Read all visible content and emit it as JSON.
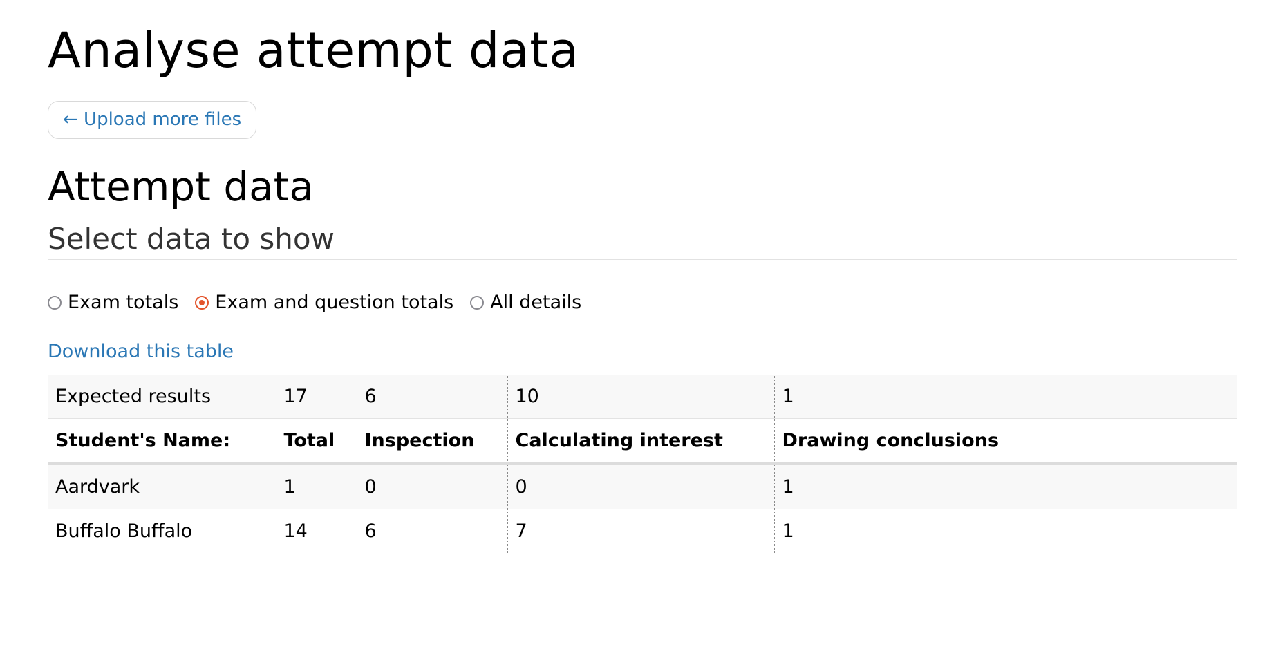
{
  "page": {
    "title": "Analyse attempt data",
    "upload_button": "← Upload more files",
    "section_title": "Attempt data",
    "subsection_title": "Select data to show"
  },
  "data_options": [
    {
      "label": "Exam totals",
      "selected": false
    },
    {
      "label": "Exam and question totals",
      "selected": true
    },
    {
      "label": "All details",
      "selected": false
    }
  ],
  "download_link": "Download this table",
  "table": {
    "expected": {
      "label": "Expected results",
      "values": [
        "17",
        "6",
        "10",
        "1"
      ]
    },
    "headers": [
      "Student's Name:",
      "Total",
      "Inspection",
      "Calculating interest",
      "Drawing conclusions"
    ],
    "rows": [
      [
        "Aardvark",
        "1",
        "0",
        "0",
        "1"
      ],
      [
        "Buffalo Buffalo",
        "14",
        "6",
        "7",
        "1"
      ]
    ]
  },
  "colors": {
    "link": "#2a77b5",
    "radio_selected": "#e3532a",
    "radio_unselected": "#8a8a90"
  }
}
